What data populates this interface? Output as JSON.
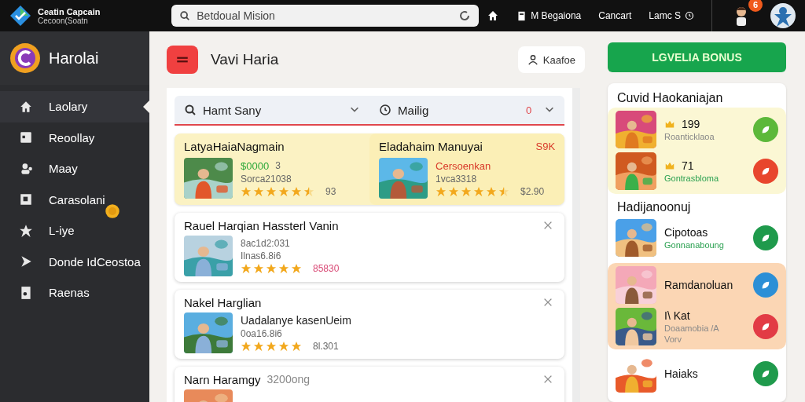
{
  "topbar": {
    "brand_name": "Ceatin Capcain",
    "brand_sub": "Cecoon(Soatn",
    "search": {
      "placeholder": "Betdoual Mision"
    },
    "nav": [
      {
        "kind": "home"
      },
      {
        "kind": "doc",
        "label": "M Begaiona"
      },
      {
        "kind": "text",
        "label": "Cancart"
      },
      {
        "kind": "clock",
        "label": "Lamc S"
      }
    ],
    "notification_count": "6"
  },
  "sidebar": {
    "title": "Harolai",
    "items": [
      {
        "label": "Laolary",
        "selected": true,
        "badge": false
      },
      {
        "label": "Reoollay",
        "selected": false,
        "badge": false
      },
      {
        "label": "Maay",
        "selected": false,
        "badge": false
      },
      {
        "label": "Carasolani",
        "selected": false,
        "badge": true
      },
      {
        "label": "L-iye",
        "selected": false,
        "badge": false
      },
      {
        "label": "Donde IdCeostoa",
        "selected": false,
        "badge": false
      },
      {
        "label": "Raenas",
        "selected": false,
        "badge": false
      }
    ]
  },
  "header": {
    "title": "Vavi Haria",
    "profile_button": "Kaafoe"
  },
  "filters": [
    {
      "label": "Hamt Sany"
    },
    {
      "label": "Mailig",
      "count": "0"
    }
  ],
  "featured": [
    {
      "title": "LatyaHaiaNagmain",
      "price": "$0000",
      "price_note": "3",
      "code": "Sorca21038",
      "stars": 5.5,
      "reading": "93"
    },
    {
      "title": "Eladahaim Manuyai",
      "corner": "S9K",
      "tagline": "Cersoenkan",
      "code": "1vca3318",
      "stars": 5.5,
      "reading": "$2.90"
    }
  ],
  "listings": [
    {
      "title": "Rauel Harqian Hassterl Vanin",
      "lines": [
        "8ac1d2:031",
        "Ilnas6.8i6"
      ],
      "stars": 5,
      "reading": "85830"
    },
    {
      "title": "Nakel Harglian",
      "headline": "Uadalanye kasenUeim",
      "lines": [
        "0oa16.8i6"
      ],
      "stars": 5,
      "reading": "8l.301"
    },
    {
      "title": "Narn Haramgy",
      "title_note": "3200ong"
    }
  ],
  "bonus_button": "LGVELIA BONUS",
  "rewards": {
    "title": "Cuvid Haokaniajan",
    "sections": [
      {
        "color": "#fbf7d4",
        "items": [
          {
            "value": "199",
            "subtitle": "Roanticklaoa",
            "color": "#5cb83a"
          },
          {
            "value": "71",
            "subtitle": "Gontrasbloma",
            "color": "#e8462d"
          }
        ]
      },
      {
        "heading": "Hadijanoonuj",
        "color": "#ffffff",
        "items": [
          {
            "name": "Cipotoas",
            "subtitle": "Gonnanaboung",
            "color": "#1f9a4c"
          }
        ]
      },
      {
        "color": "#fbd6b4",
        "items": [
          {
            "name": "Ramdanoluan",
            "color": "#2c8fd6"
          },
          {
            "name": "I\\ Kat",
            "subtitle": "Doaamobia /A",
            "subtitle2": "Vorv",
            "color": "#e23b45"
          }
        ]
      },
      {
        "color": "#ffffff",
        "items": [
          {
            "name": "Haiaks",
            "color": "#1f9a4c"
          }
        ]
      }
    ]
  }
}
